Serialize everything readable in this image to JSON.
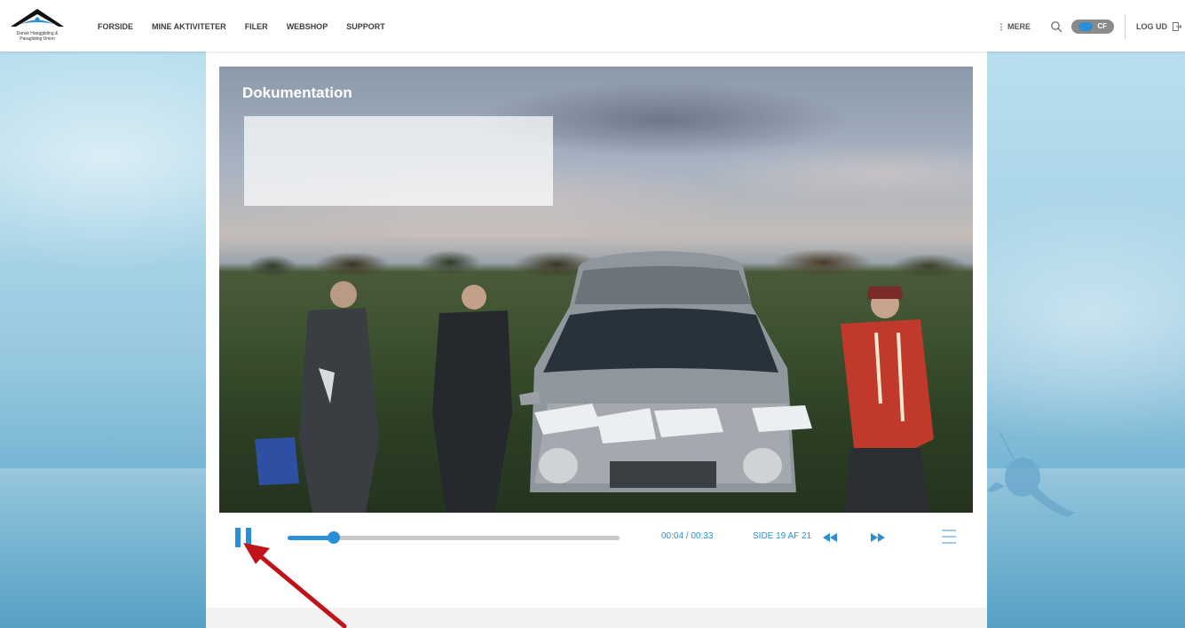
{
  "header": {
    "logo_text": "Dansk Hanggliding & Paragliding Union",
    "nav": [
      "FORSIDE",
      "MINE AKTIVITETER",
      "FILER",
      "WEBSHOP",
      "SUPPORT"
    ],
    "more_label": "⋮ MERE",
    "toggle_label": "CF",
    "logout_label": "LOG UD"
  },
  "slide": {
    "title": "Dokumentation"
  },
  "player": {
    "time": "00:04 / 00:33",
    "page": "SIDE 19 AF 21",
    "progress_fraction": 0.14
  },
  "colors": {
    "accent": "#2b8fd6",
    "annotation_arrow": "#c0141a"
  },
  "icons": {
    "search": "search-icon",
    "logout": "logout-icon",
    "pause": "pause-icon",
    "rewind": "rewind-icon",
    "forward": "fast-forward-icon",
    "menu": "menu-icon"
  }
}
